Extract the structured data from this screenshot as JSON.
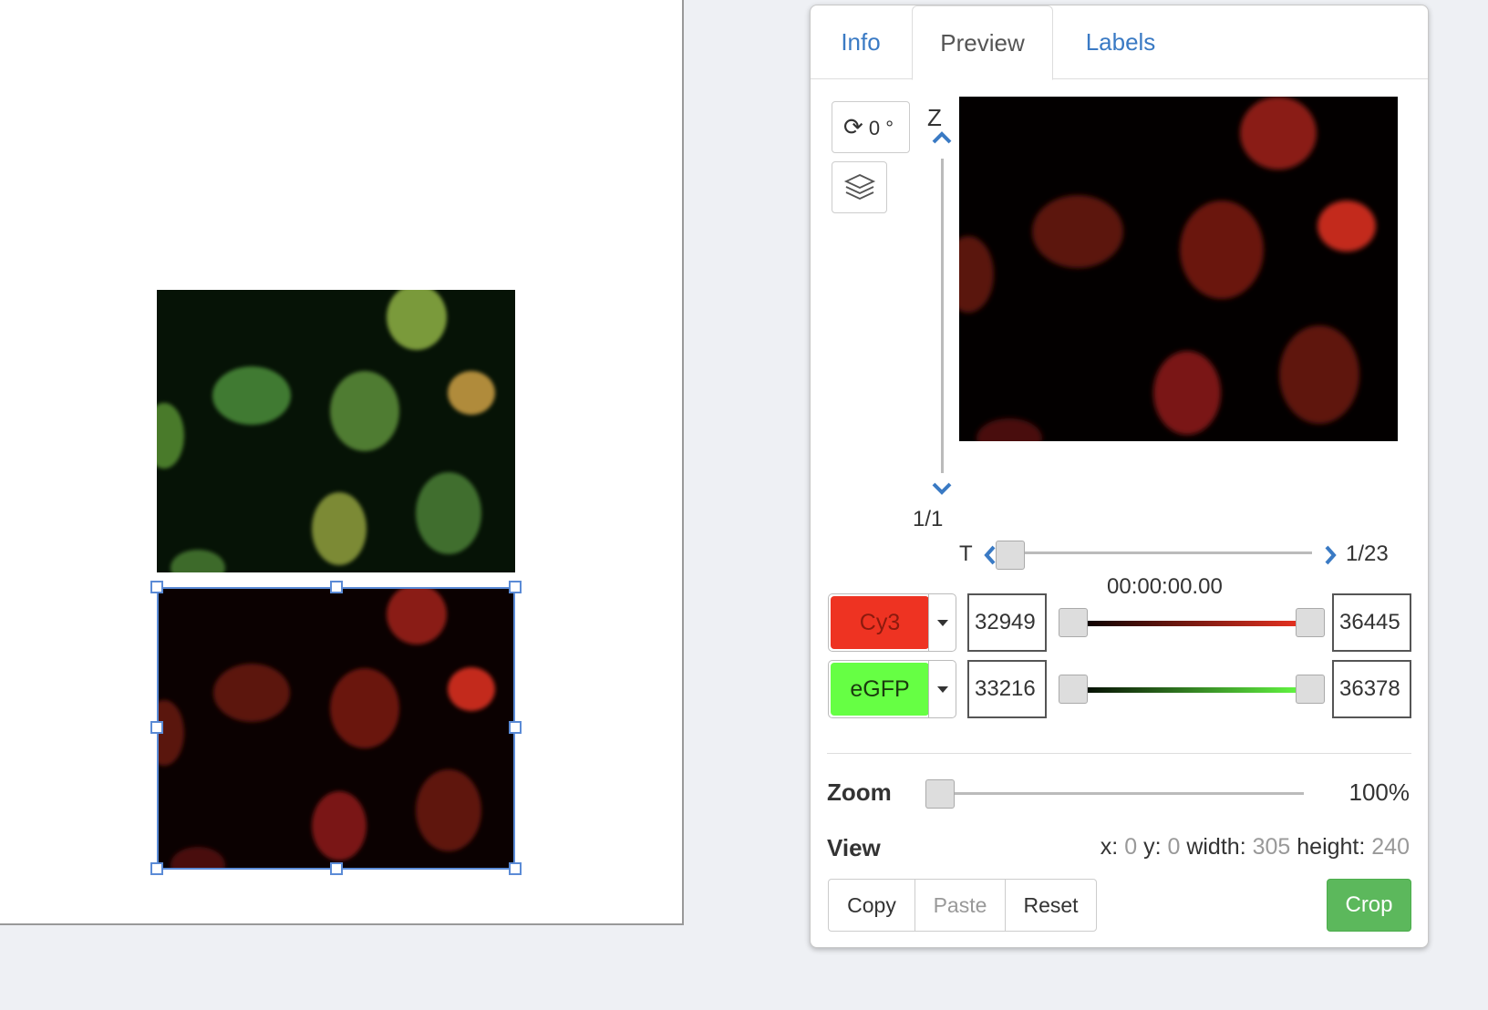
{
  "tabs": [
    {
      "label": "Info"
    },
    {
      "label": "Preview"
    },
    {
      "label": "Labels"
    }
  ],
  "rotation": {
    "value": "0 °"
  },
  "z": {
    "label": "Z",
    "count": "1/1"
  },
  "t": {
    "label": "T",
    "count": "1/23",
    "timestamp": "00:00:00.00",
    "position": 0
  },
  "channels": [
    {
      "name": "Cy3",
      "color": "#ee3322",
      "min": "32949",
      "max": "36445",
      "text_color": "#8b1a0e"
    },
    {
      "name": "eGFP",
      "color": "#66ff44",
      "min": "33216",
      "max": "36378",
      "text_color": "#1a3a0e"
    }
  ],
  "zoom": {
    "label": "Zoom",
    "value": "100%"
  },
  "view": {
    "label": "View",
    "x_label": "x:",
    "x": "0",
    "y_label": "y:",
    "y": "0",
    "width_label": "width:",
    "width": "305",
    "height_label": "height:",
    "height": "240"
  },
  "buttons": {
    "copy": "Copy",
    "paste": "Paste",
    "reset": "Reset",
    "crop": "Crop"
  },
  "colors": {
    "accent": "#3a7ac4",
    "selection": "#5b8bd6",
    "crop": "#5cb85c"
  }
}
